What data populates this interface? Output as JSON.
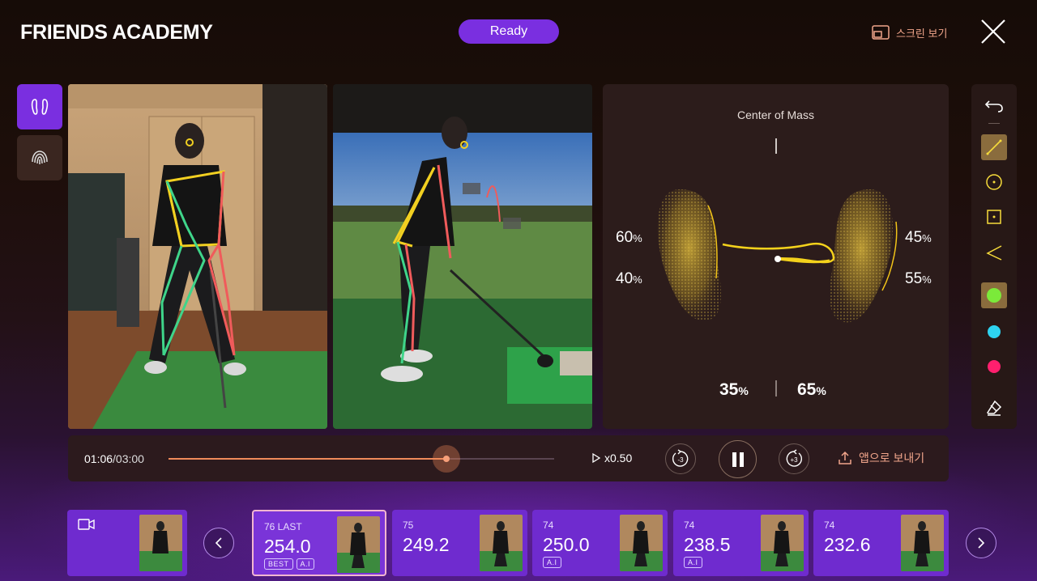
{
  "header": {
    "brand": "FRIENDS ACADEMY",
    "status": "Ready",
    "screen_view_label": "스크린 보기"
  },
  "left_tools": [
    "feet-pressure-icon",
    "fingerprint-icon"
  ],
  "center_of_mass": {
    "title": "Center of Mass",
    "left_foot_toe": "60",
    "left_foot_heel": "40",
    "right_foot_toe": "45",
    "right_foot_heel": "55",
    "left_total": "35",
    "right_total": "65",
    "pct_sign": "%"
  },
  "draw_tools": [
    "undo-icon",
    "line-icon",
    "circle-icon",
    "square-icon",
    "angle-icon",
    "color-green",
    "color-cyan",
    "color-pink",
    "eraser-icon"
  ],
  "colors": {
    "accent": "#7a2fe0",
    "green": "#7bea3a",
    "cyan": "#2ed3f0",
    "pink": "#ff1f6e",
    "highlight": "#f1a58b"
  },
  "playback": {
    "current": "01:06",
    "total": "/03:00",
    "progress": 0.72,
    "speed": "x0.50",
    "rewind_label": "-3",
    "forward_label": "+3",
    "send_label": "앱으로 보내기"
  },
  "shots": [
    {
      "rank": "76 LAST",
      "distance": "254.0",
      "tags": [
        "BEST",
        "A.I"
      ]
    },
    {
      "rank": "75",
      "distance": "249.2",
      "tags": []
    },
    {
      "rank": "74",
      "distance": "250.0",
      "tags": [
        "A.I"
      ]
    },
    {
      "rank": "74",
      "distance": "238.5",
      "tags": [
        "A.I"
      ]
    },
    {
      "rank": "74",
      "distance": "232.6",
      "tags": []
    }
  ]
}
